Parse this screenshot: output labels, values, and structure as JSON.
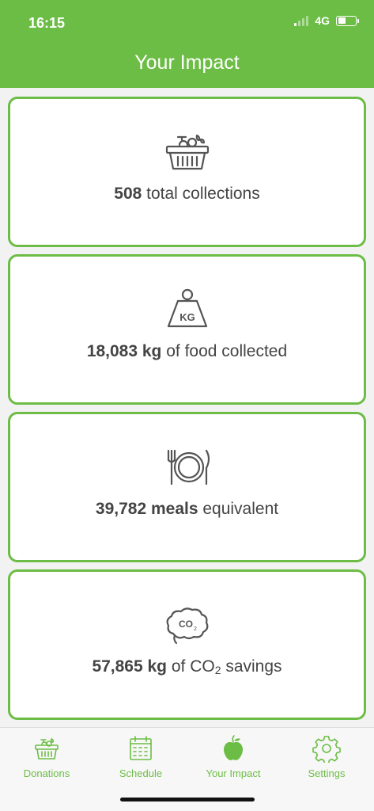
{
  "status_bar": {
    "time": "16:15",
    "network": "4G",
    "signal_bars": 1,
    "battery_level": 0.45
  },
  "header": {
    "title": "Your Impact"
  },
  "stats": [
    {
      "icon": "basket-icon",
      "value": "508",
      "text": " total collections"
    },
    {
      "icon": "kg-weight-icon",
      "value": "18,083 kg",
      "text": " of food collected"
    },
    {
      "icon": "plate-cutlery-icon",
      "value": "39,782 meals",
      "text": " equivalent"
    },
    {
      "icon": "co2-cloud-icon",
      "value": "57,865 kg",
      "text_pre": " of CO",
      "text_sub": "2",
      "text_post": " savings"
    }
  ],
  "tabs": [
    {
      "label": "Donations",
      "icon": "basket-icon"
    },
    {
      "label": "Schedule",
      "icon": "calendar-icon"
    },
    {
      "label": "Your Impact",
      "icon": "apple-icon",
      "active": true
    },
    {
      "label": "Settings",
      "icon": "gear-icon"
    }
  ],
  "colors": {
    "accent": "#6cbd45",
    "text": "#444444",
    "icon": "#555555"
  }
}
